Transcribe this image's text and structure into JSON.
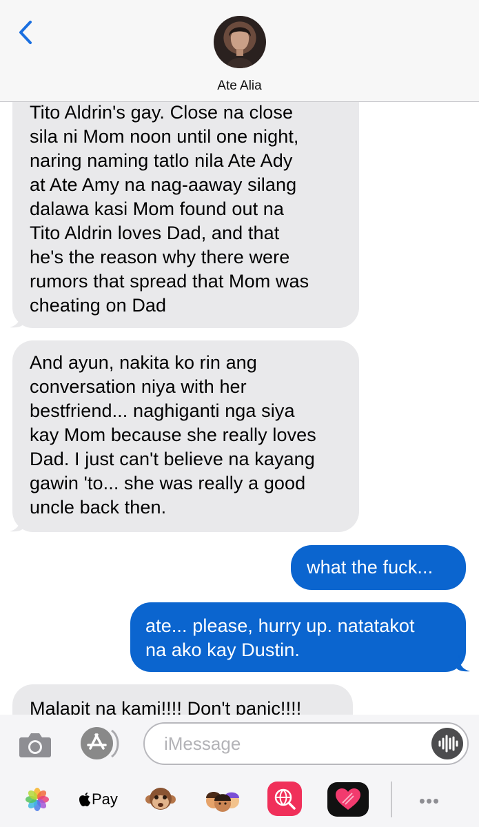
{
  "header": {
    "contact_name": "Ate Alia"
  },
  "messages": [
    {
      "direction": "incoming",
      "text": "Tito Aldrin's gay. Close na close\nsila ni Mom noon until one night,\nnaring naming tatlo nila Ate Ady\nat Ate Amy na nag-aaway silang\ndalawa kasi Mom found out na\nTito Aldrin loves Dad, and that\nhe's the reason why there were\nrumors that spread that Mom was\ncheating on Dad"
    },
    {
      "direction": "incoming",
      "text": "And ayun, nakita ko rin ang\nconversation niya with her\nbestfriend... naghiganti nga siya\nkay Mom because she really loves\nDad. I just can't believe na kayang\ngawin 'to... she was really a good\nuncle back then."
    },
    {
      "direction": "outgoing",
      "text": "what the fuck..."
    },
    {
      "direction": "outgoing",
      "text": "ate... please, hurry up. natatakot\nna ako kay Dustin."
    },
    {
      "direction": "incoming",
      "text": "Malapit na kami!!!! Don't panic!!!!"
    }
  ],
  "compose": {
    "placeholder": "iMessage"
  },
  "app_drawer": {
    "apple_pay_label": "Pay",
    "more_label": "•••"
  },
  "colors": {
    "incoming_bubble": "#e9e9eb",
    "outgoing_bubble": "#0b65cf",
    "back_chevron": "#1a6fe0"
  }
}
